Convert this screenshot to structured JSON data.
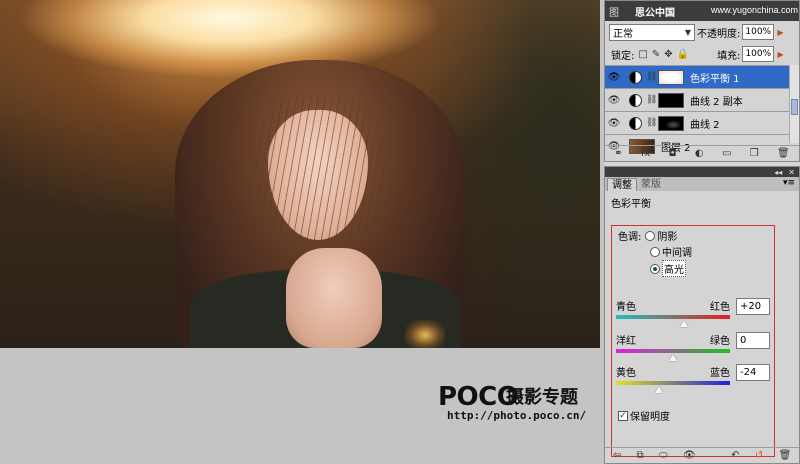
{
  "watermark": {
    "logo": "POCO",
    "subtitle": "摄影专题",
    "url": "http://photo.poco.cn/"
  },
  "site_watermark": {
    "name": "思公中国",
    "url": "www.yugonchina.com"
  },
  "layers_panel": {
    "tab_label": "图",
    "blend_mode": "正常",
    "opacity_label": "不透明度:",
    "opacity_value": "100%",
    "lock_label": "锁定:",
    "fill_label": "填充:",
    "fill_value": "100%",
    "layers": [
      {
        "name": "色彩平衡 1",
        "selected": true,
        "kind": "adjustment",
        "mask": "white"
      },
      {
        "name": "曲线 2 副本",
        "selected": false,
        "kind": "adjustment",
        "mask": "black"
      },
      {
        "name": "曲线 2",
        "selected": false,
        "kind": "adjustment",
        "mask": "black2"
      },
      {
        "name": "图层 2",
        "selected": false,
        "kind": "pixel",
        "mask": "photo"
      }
    ]
  },
  "adjustments_panel": {
    "tabs": [
      {
        "label": "调整",
        "active": true
      },
      {
        "label": "蒙版",
        "active": false
      }
    ],
    "title": "色彩平衡",
    "tone_label": "色调:",
    "tone_options": [
      {
        "label": "阴影",
        "selected": false
      },
      {
        "label": "中间调",
        "selected": false
      },
      {
        "label": "高光",
        "selected": true
      }
    ],
    "sliders": [
      {
        "left": "青色",
        "right": "红色",
        "value": "+20",
        "level": 20,
        "gradient": [
          "#20c0c0",
          "#e02020"
        ]
      },
      {
        "left": "洋红",
        "right": "绿色",
        "value": "0",
        "level": 0,
        "gradient": [
          "#e020e0",
          "#20c020"
        ]
      },
      {
        "left": "黄色",
        "right": "蓝色",
        "value": "-24",
        "level": -24,
        "gradient": [
          "#e0e020",
          "#2020e0"
        ]
      }
    ],
    "preserve_luminosity_label": "保留明度",
    "preserve_luminosity_checked": true
  },
  "colors": {
    "selection_blue": "#3169c6",
    "highlight_box": "#d03030"
  }
}
